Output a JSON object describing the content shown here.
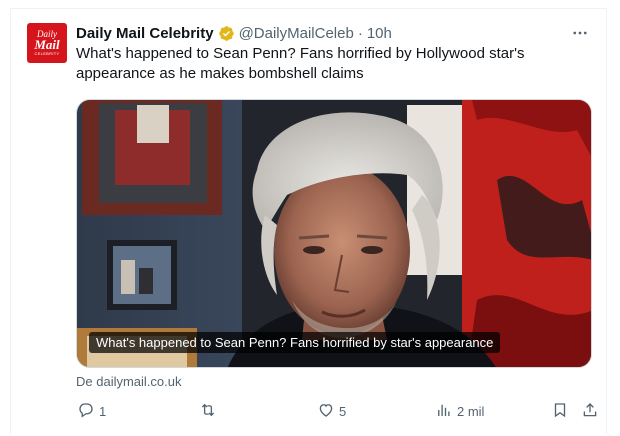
{
  "tweet": {
    "avatar": {
      "line1": "Daily",
      "line2": "Mail",
      "line3": "CELEBRITY"
    },
    "author_name": "Daily Mail Celebrity",
    "handle": "@DailyMailCeleb",
    "separator": "·",
    "time": "10h",
    "text": "What's happened to Sean Penn? Fans horrified by Hollywood star's appearance as he makes bombshell claims",
    "media_caption": "What's happened to Sean Penn? Fans horrified by star's appearance",
    "source": "De dailymail.co.uk",
    "actions": {
      "reply_count": "1",
      "retweet_count": "",
      "like_count": "5",
      "views_count": "2 mil"
    }
  },
  "colors": {
    "brand_red": "#d6141c",
    "verified_gold": "#e2b719",
    "muted_text": "#536471",
    "primary_text": "#0f1419"
  },
  "icons": {
    "verified": "verified-badge-icon",
    "more": "more-icon",
    "reply": "reply-icon",
    "retweet": "retweet-icon",
    "like": "heart-icon",
    "views": "views-chart-icon",
    "bookmark": "bookmark-icon",
    "share": "share-icon"
  }
}
